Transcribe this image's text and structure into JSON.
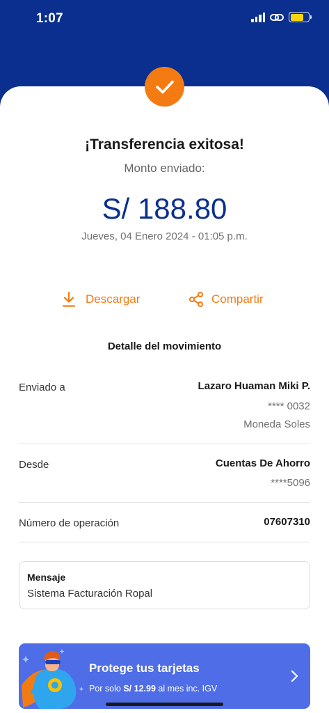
{
  "status_bar": {
    "time": "1:07"
  },
  "receipt": {
    "title": "¡Transferencia exitosa!",
    "amount_label": "Monto enviado:",
    "amount": "S/ 188.80",
    "datetime": "Jueves, 04 Enero 2024 - 01:05 p.m."
  },
  "actions": {
    "download_label": "Descargar",
    "share_label": "Compartir"
  },
  "details": {
    "section_title": "Detalle del movimiento",
    "sent_to": {
      "label": "Enviado a",
      "name": "Lazaro Huaman Miki P.",
      "account": "**** 0032",
      "currency": "Moneda Soles"
    },
    "from": {
      "label": "Desde",
      "account_type": "Cuentas De Ahorro",
      "account": "****5096"
    },
    "operation": {
      "label": "Número de operación",
      "number": "07607310"
    }
  },
  "message": {
    "label": "Mensaje",
    "text": "Sistema Facturación Ropal"
  },
  "promo": {
    "title": "Protege tus tarjetas",
    "sub_prefix": "Por solo",
    "sub_price": "S/ 12.99",
    "sub_suffix": "al mes inc. IGV"
  },
  "colors": {
    "header_blue": "#0a2f8f",
    "accent_orange": "#f47b12",
    "promo_blue": "#4e6de6",
    "battery_yellow": "#f8d60b"
  },
  "icons": [
    "signal-icon",
    "link-icon",
    "battery-icon",
    "check-icon",
    "download-icon",
    "share-icon",
    "chevron-right-icon",
    "superhero-illustration"
  ]
}
